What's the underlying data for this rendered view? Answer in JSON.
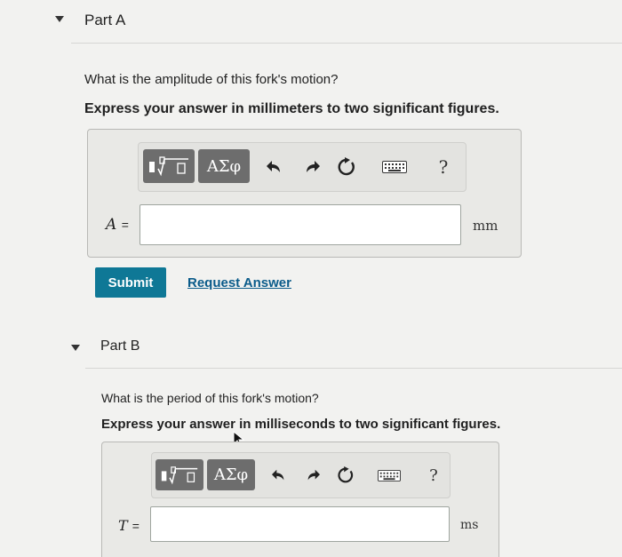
{
  "part_a": {
    "title": "Part A",
    "question": "What is the amplitude of this fork's motion?",
    "instruction": "Express your answer in millimeters to two significant figures.",
    "toolbar": {
      "greek_label": "ΑΣφ",
      "help_label": "?"
    },
    "variable": "A",
    "equals": "=",
    "input_value": "",
    "unit": "mm",
    "submit_label": "Submit",
    "request_answer_label": "Request Answer"
  },
  "part_b": {
    "title": "Part B",
    "question": "What is the period of this fork's motion?",
    "instruction": "Express your answer in milliseconds to two significant figures.",
    "toolbar": {
      "greek_label": "ΑΣφ",
      "help_label": "?"
    },
    "variable": "T",
    "equals": "=",
    "input_value": "",
    "unit": "ms"
  },
  "colors": {
    "submit": "#0f7896",
    "link": "#0a5b8a",
    "tool_button": "#6d6d6d"
  },
  "icons": {
    "collapse": "caret-down-icon",
    "templates": "templates-icon",
    "undo": "undo-icon",
    "redo": "redo-icon",
    "reset": "reset-icon",
    "keyboard": "keyboard-icon",
    "help": "help-icon"
  }
}
